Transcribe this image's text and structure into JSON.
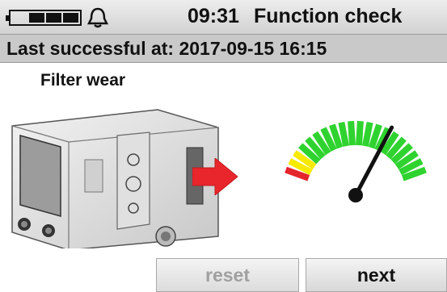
{
  "header": {
    "battery_level": 0.75,
    "alarm_icon": "bell-icon",
    "time": "09:31",
    "title": "Function check"
  },
  "status": {
    "last_success_text": "Last successful at: 2017-09-15 16:15"
  },
  "main": {
    "section_label": "Filter wear",
    "device_icon": "ventilator-device",
    "arrow_icon": "arrow-right-icon",
    "gauge": {
      "level": 0.7,
      "colors": {
        "low": "#e4262c",
        "warn": "#f7e900",
        "ok": "#2fd32f"
      }
    }
  },
  "buttons": {
    "reset_label": "reset",
    "next_label": "next"
  }
}
